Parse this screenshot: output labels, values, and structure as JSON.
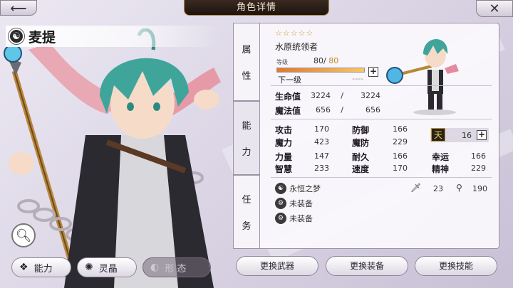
{
  "header": {
    "title": "角色详情",
    "back_icon": "back-arrow-icon",
    "close_icon": "close-icon"
  },
  "character": {
    "name": "麦提",
    "element_icon": "yin-yang-icon",
    "stars": "☆☆☆☆☆",
    "class_name": "水原统领者",
    "level_label": "等级",
    "level": "80",
    "level_sep": "/",
    "level_max": "80",
    "level_progress": 1.0,
    "next_label": "下一级",
    "next_value": "----"
  },
  "side_tabs": [
    {
      "label_1": "属",
      "label_2": "性"
    },
    {
      "label_1": "能",
      "label_2": "力"
    },
    {
      "label_1": "任",
      "label_2": "务"
    }
  ],
  "vitals": {
    "hp_label": "生命值",
    "hp": "3224",
    "hp_sep": "/",
    "hp_max": "3224",
    "mp_label": "魔法值",
    "mp": "656",
    "mp_sep": "/",
    "mp_max": "656"
  },
  "stats": {
    "atk_label": "攻击",
    "atk": "170",
    "def_label": "防御",
    "def": "166",
    "mag_label": "魔力",
    "mag": "423",
    "mdef_label": "魔防",
    "mdef": "229",
    "str_label": "力量",
    "str": "147",
    "end_label": "耐久",
    "end": "166",
    "luck_label": "幸运",
    "luck": "166",
    "int_label": "智慧",
    "int": "233",
    "spd_label": "速度",
    "spd": "170",
    "spi_label": "精神",
    "spi": "229",
    "sky_badge": "天",
    "sky_value": "16"
  },
  "equipment": {
    "item1": "永恒之梦",
    "item2": "未装备",
    "item3": "未装备",
    "sword_value": "23",
    "wand_value": "190"
  },
  "bottom_tabs": {
    "ability": "能力",
    "spirit": "灵晶",
    "form": "形 态"
  },
  "actions": {
    "weapon": "更换武器",
    "equipment": "更换装备",
    "skill": "更换技能"
  },
  "colors": {
    "accent_gold": "#c9a036",
    "level_bar": "#e07a2a",
    "panel_bg": "#faf8fc"
  }
}
